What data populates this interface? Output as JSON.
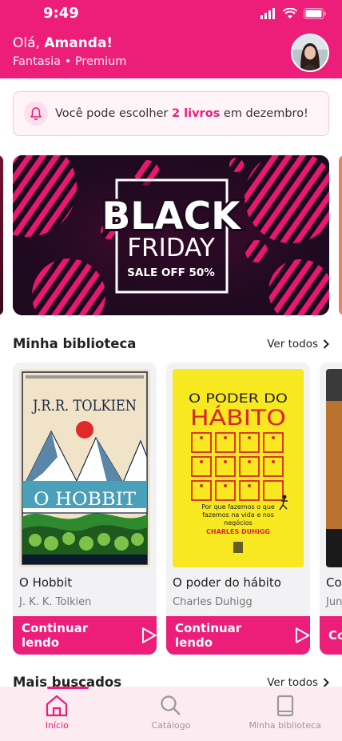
{
  "status_bar": {
    "time": "9:49"
  },
  "header": {
    "greeting_prefix": "Olá, ",
    "user_name": "Amanda!",
    "subtitle": "Fantasia • Premium"
  },
  "notice": {
    "text_before": "Você pode escolher ",
    "highlight": "2 livros",
    "text_after": " em dezembro!"
  },
  "banner": {
    "line1": "BLACK",
    "line2": "FRIDAY",
    "line3": "SALE OFF 50%"
  },
  "library": {
    "title": "Minha biblioteca",
    "see_all": "Ver todos",
    "books": [
      {
        "title": "O Hobbit",
        "author": "J. K. K. Tolkien",
        "cover_author": "J.R.R. TOLKIEN",
        "cover_title": "O HOBBIT",
        "button": "Continuar lendo"
      },
      {
        "title": "O poder do hábito",
        "author": "Charles Duhigg",
        "cover_line1": "O PODER DO",
        "cover_line2": "HÁBITO",
        "cover_tagline": "Por que fazemos o que fazemos na vida e nos negócios",
        "cover_author": "CHARLES DUHIGG",
        "button": "Continuar lendo"
      },
      {
        "title": "Co",
        "author": "Jun",
        "button": "Co"
      }
    ]
  },
  "most_searched": {
    "title": "Mais buscados",
    "see_all": "Ver todos"
  },
  "bottom_nav": [
    {
      "label": "Início",
      "icon": "home-icon",
      "active": true
    },
    {
      "label": "Catálogo",
      "icon": "search-icon",
      "active": false
    },
    {
      "label": "Minha biblioteca",
      "icon": "book-icon",
      "active": false
    }
  ],
  "colors": {
    "accent": "#ec1e79",
    "banner_bg": "#1d0a1f",
    "hobbit_cover": "#f0e3c8",
    "habit_cover": "#f7e81f"
  }
}
